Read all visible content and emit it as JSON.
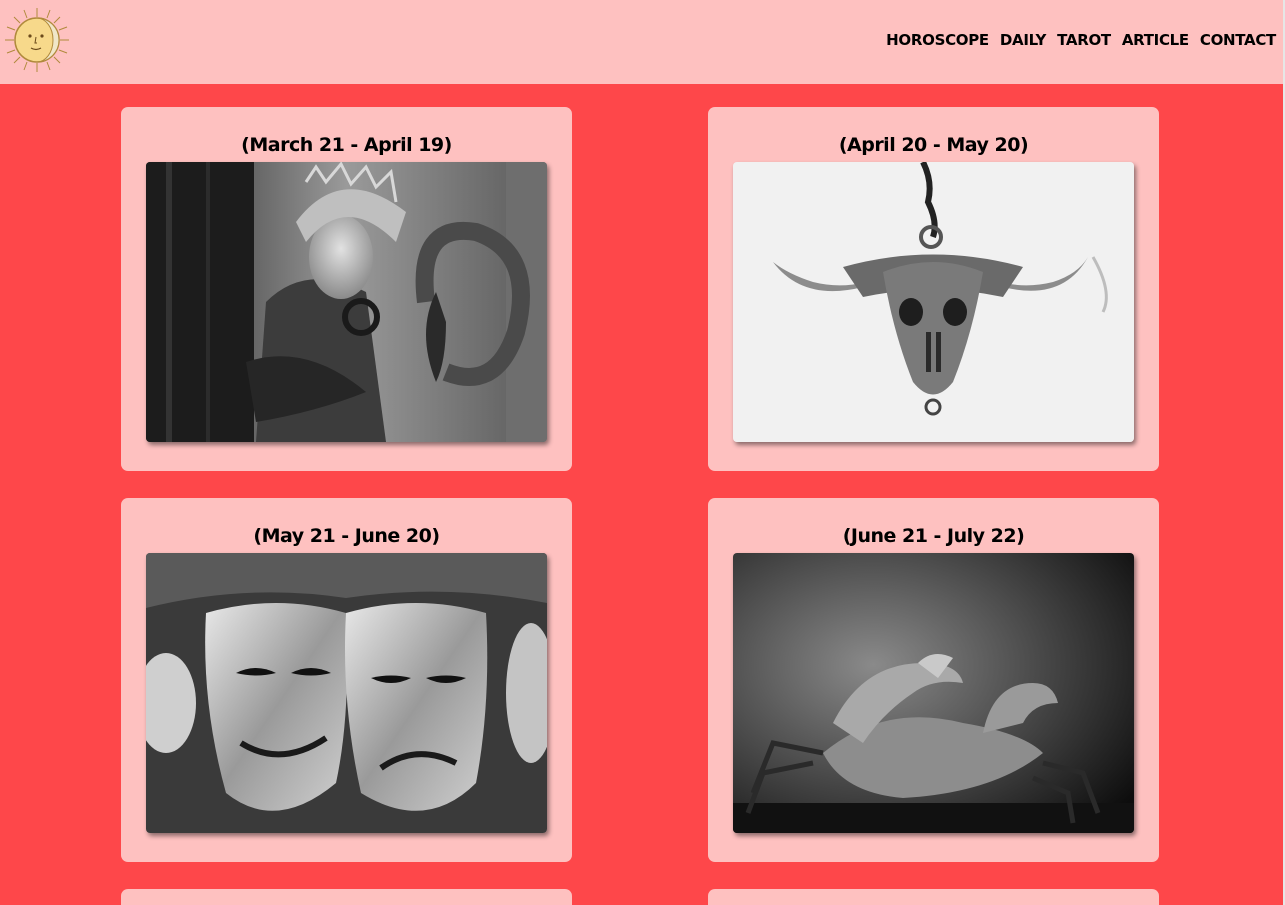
{
  "header": {
    "logo_icon": "sun-moon-icon",
    "nav": [
      {
        "label": "HOROSCOPE"
      },
      {
        "label": "DAILY"
      },
      {
        "label": "TAROT"
      },
      {
        "label": "ARTICLE"
      },
      {
        "label": "CONTACT"
      }
    ]
  },
  "cards": [
    {
      "date_range": "(March 21 - April 19)",
      "image": "woman-with-ram-horn-headdress"
    },
    {
      "date_range": "(April 20 - May 20)",
      "image": "bull-skull-pendant"
    },
    {
      "date_range": "(May 21 - June 20)",
      "image": "comedy-tragedy-masks"
    },
    {
      "date_range": "(June 21 - July 22)",
      "image": "crab"
    }
  ],
  "colors": {
    "page_background": "#fe474a",
    "header_background": "#fec1c0",
    "card_background": "#fec1c0",
    "text": "#000000"
  }
}
